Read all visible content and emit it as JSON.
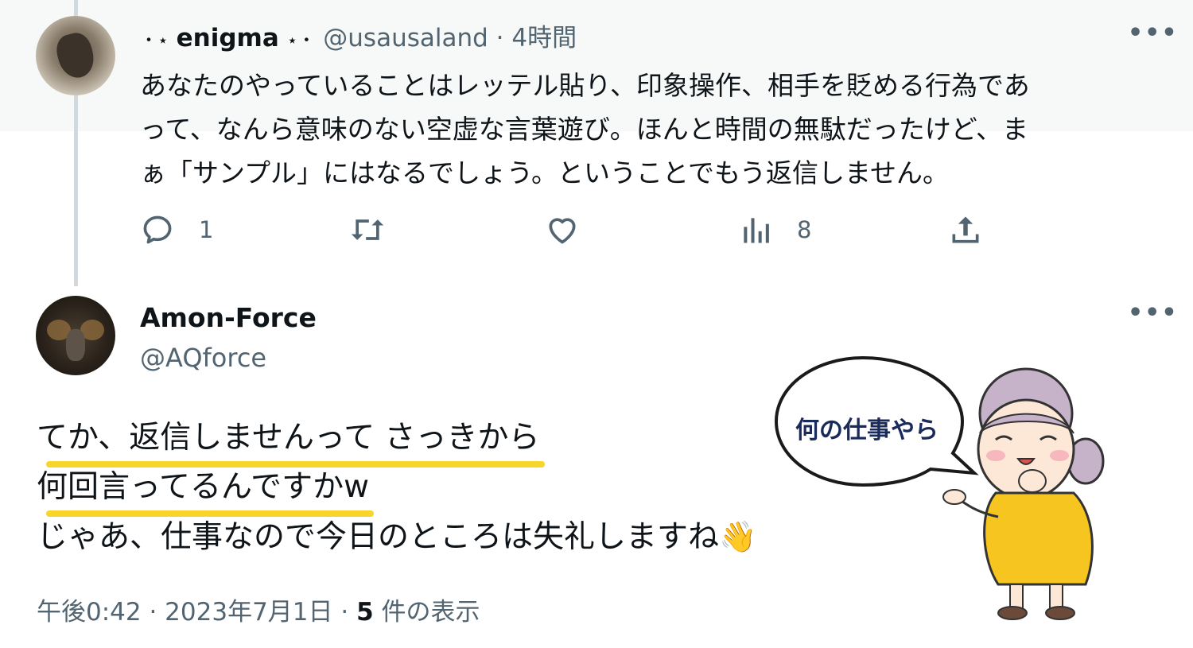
{
  "tweet1": {
    "stars_left": "・⋆",
    "name": "enigma",
    "stars_right": "⋆・",
    "handle_time": "@usausaland · 4時間",
    "body_lines": [
      "あなたのやっていることはレッテル貼り、印象操作、相手を貶める行為であ",
      "って、なんら意味のない空虚な言葉遊び。ほんと時間の無駄だったけど、ま",
      "ぁ「サンプル」にはなるでしょう。ということでもう返信しません。"
    ],
    "actions": {
      "reply_count": "1",
      "views_count": "8"
    }
  },
  "tweet2": {
    "name": "Amon-Force",
    "handle": "@AQforce",
    "lines": [
      "てか、返信しませんって さっきから",
      "何回言ってるんですかw",
      "じゃあ、仕事なので今日のところは失礼しますね"
    ],
    "wave_emoji": "👋",
    "meta": {
      "time_date": "午後0:42 · 2023年7月1日 · ",
      "views_num": "5",
      "views_label": " 件の表示"
    }
  },
  "sticker": {
    "bubble_text": "何の仕事やら"
  },
  "colors": {
    "text_primary": "#0f1419",
    "text_secondary": "#536471",
    "highlight": "#f7d52a",
    "thread_line": "#cfd9de"
  },
  "icons": [
    "more-icon",
    "reply-icon",
    "retweet-icon",
    "like-icon",
    "views-icon",
    "share-icon",
    "wave-emoji"
  ]
}
